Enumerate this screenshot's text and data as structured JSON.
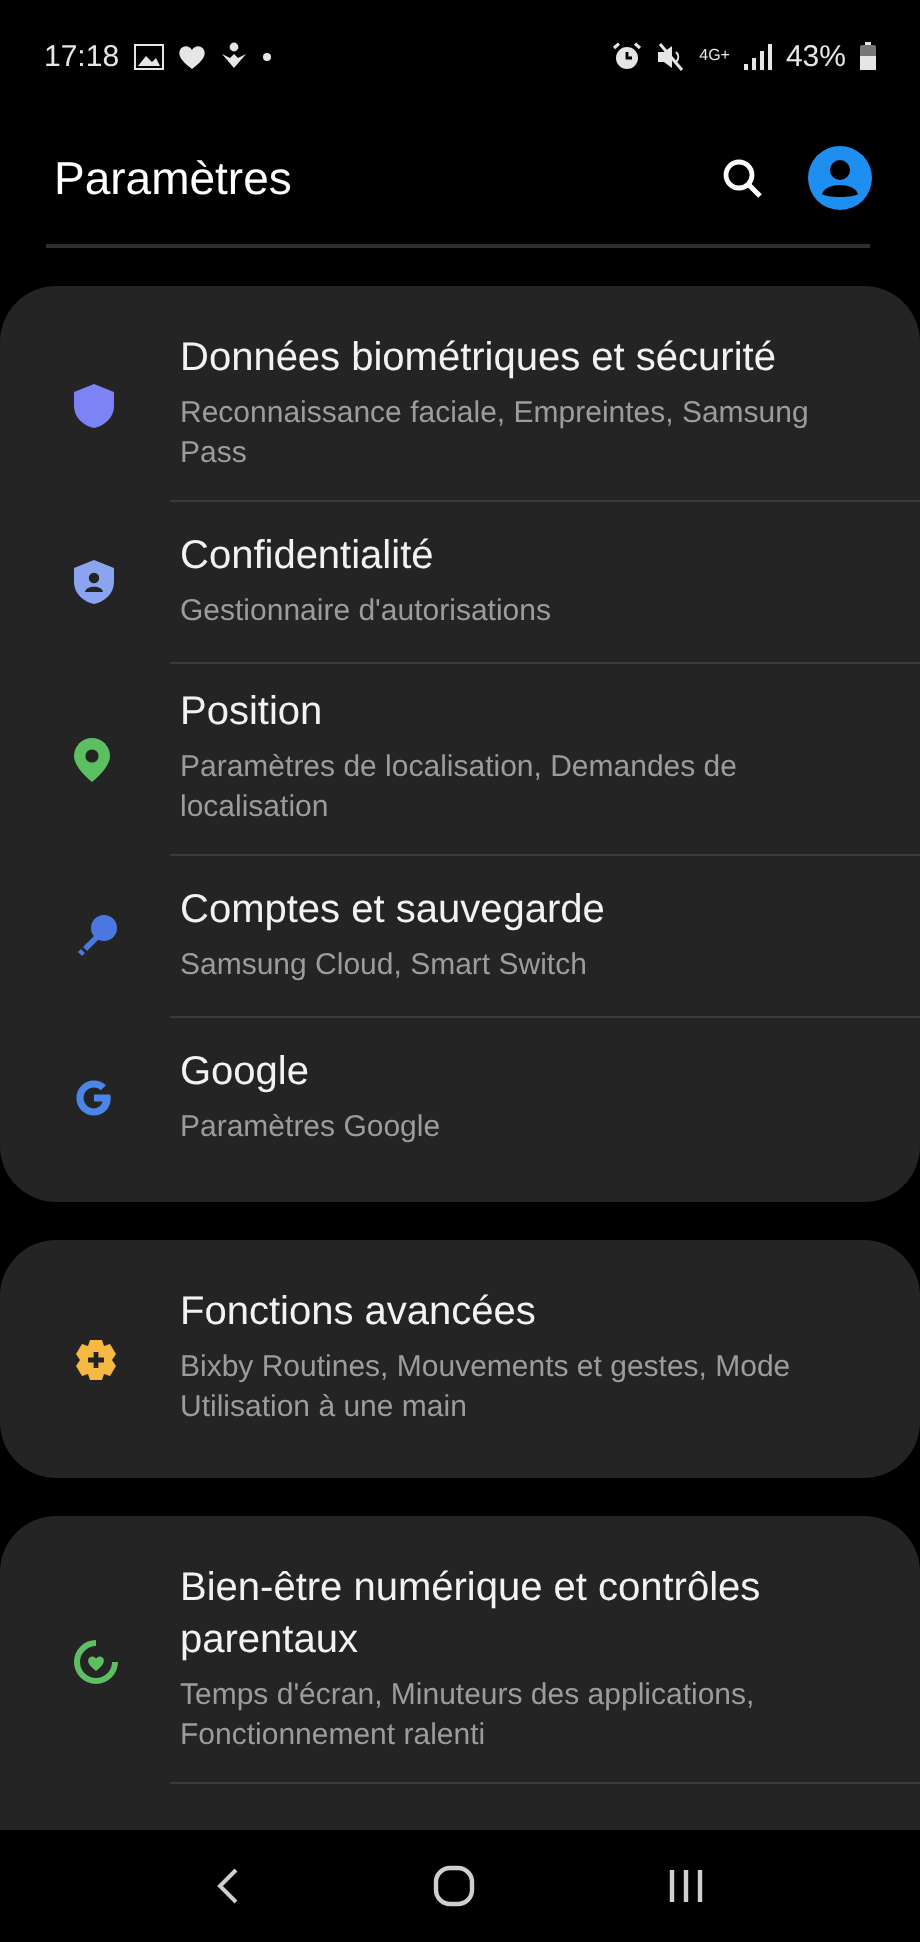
{
  "status_bar": {
    "time": "17:18",
    "network": "4G+",
    "battery": "43%"
  },
  "header": {
    "title": "Paramètres"
  },
  "groups": [
    {
      "items": [
        {
          "title": "Données biométriques et sécurité",
          "subtitle": "Reconnaissance faciale, Empreintes, Samsung Pass",
          "color": "#7b83f5"
        },
        {
          "title": "Confidentialité",
          "subtitle": "Gestionnaire d'autorisations",
          "color": "#8aa4f0"
        },
        {
          "title": "Position",
          "subtitle": "Paramètres de localisation, Demandes de localisation",
          "color": "#5cbf62"
        },
        {
          "title": "Comptes et sauvegarde",
          "subtitle": "Samsung Cloud, Smart Switch",
          "color": "#4a78e0"
        },
        {
          "title": "Google",
          "subtitle": "Paramètres Google",
          "color": "#4a86e8"
        }
      ]
    },
    {
      "items": [
        {
          "title": "Fonctions avancées",
          "subtitle": "Bixby Routines, Mouvements et gestes, Mode Utilisation à une main",
          "color": "#f5b843"
        }
      ]
    },
    {
      "items": [
        {
          "title": "Bien-être numérique et contrôles parentaux",
          "subtitle": "Temps d'écran, Minuteurs des applications, Fonctionnement ralenti",
          "color": "#5cbf62"
        }
      ],
      "cut_off": true
    }
  ]
}
